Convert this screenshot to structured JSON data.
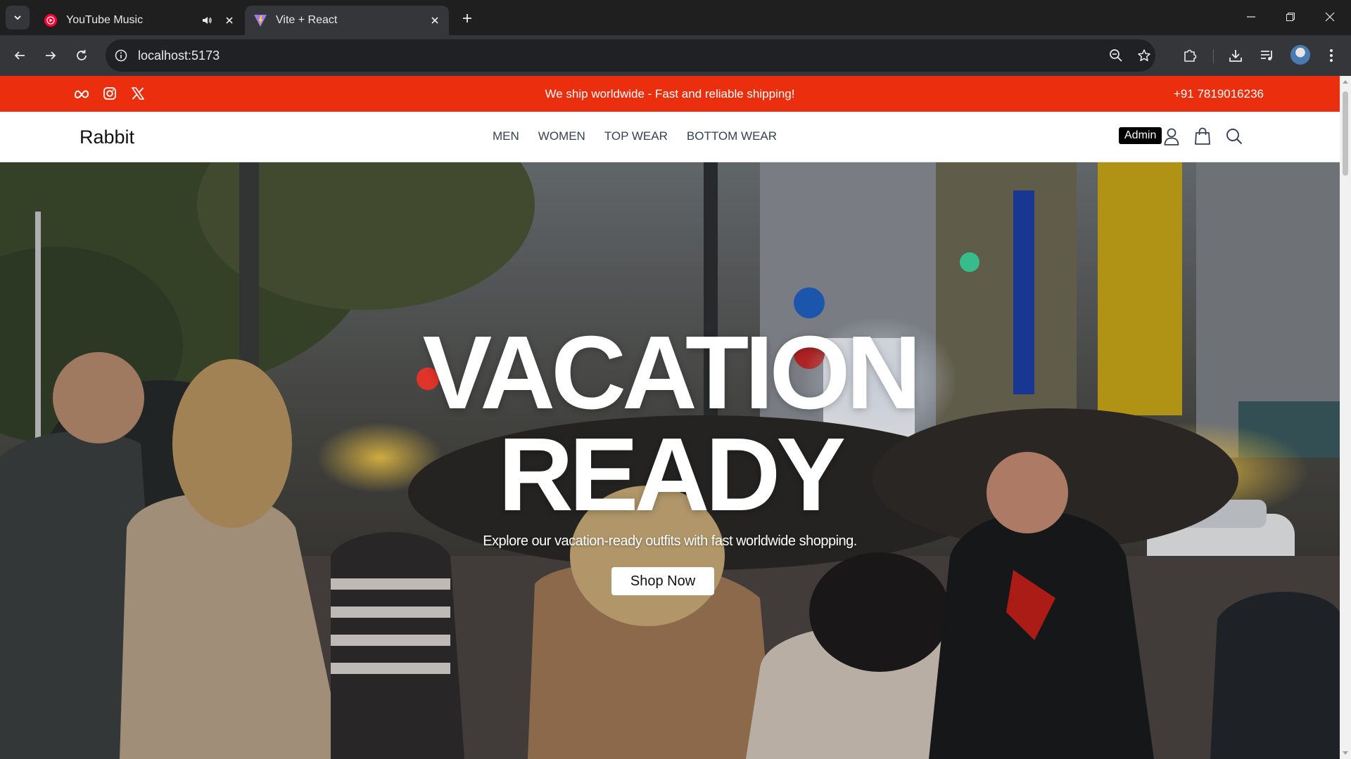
{
  "browser": {
    "tabs": [
      {
        "title": "YouTube Music",
        "favicon": "youtube-music-icon",
        "audio": true,
        "active": false
      },
      {
        "title": "Vite + React",
        "favicon": "vite-icon",
        "active": true
      }
    ],
    "url": "localhost:5173"
  },
  "colors": {
    "brand_bar": "#ea2e0e",
    "chrome_dark": "#1f1f1f",
    "chrome_toolbar": "#35363a"
  },
  "topbar": {
    "socials": [
      "meta-icon",
      "instagram-icon",
      "x-icon"
    ],
    "message": "We ship worldwide - Fast and reliable shipping!",
    "phone": "+91 7819016236"
  },
  "navbar": {
    "logo": "Rabbit",
    "links": [
      "MEN",
      "WOMEN",
      "TOP WEAR",
      "BOTTOM WEAR"
    ],
    "admin_label": "Admin",
    "icons": [
      "user-icon",
      "shopping-bag-icon",
      "search-icon"
    ]
  },
  "hero": {
    "title_line1": "VACATION",
    "title_line2": "READY",
    "subtitle": "Explore our vacation-ready outfits with fast worldwide shopping.",
    "cta": "Shop Now"
  }
}
